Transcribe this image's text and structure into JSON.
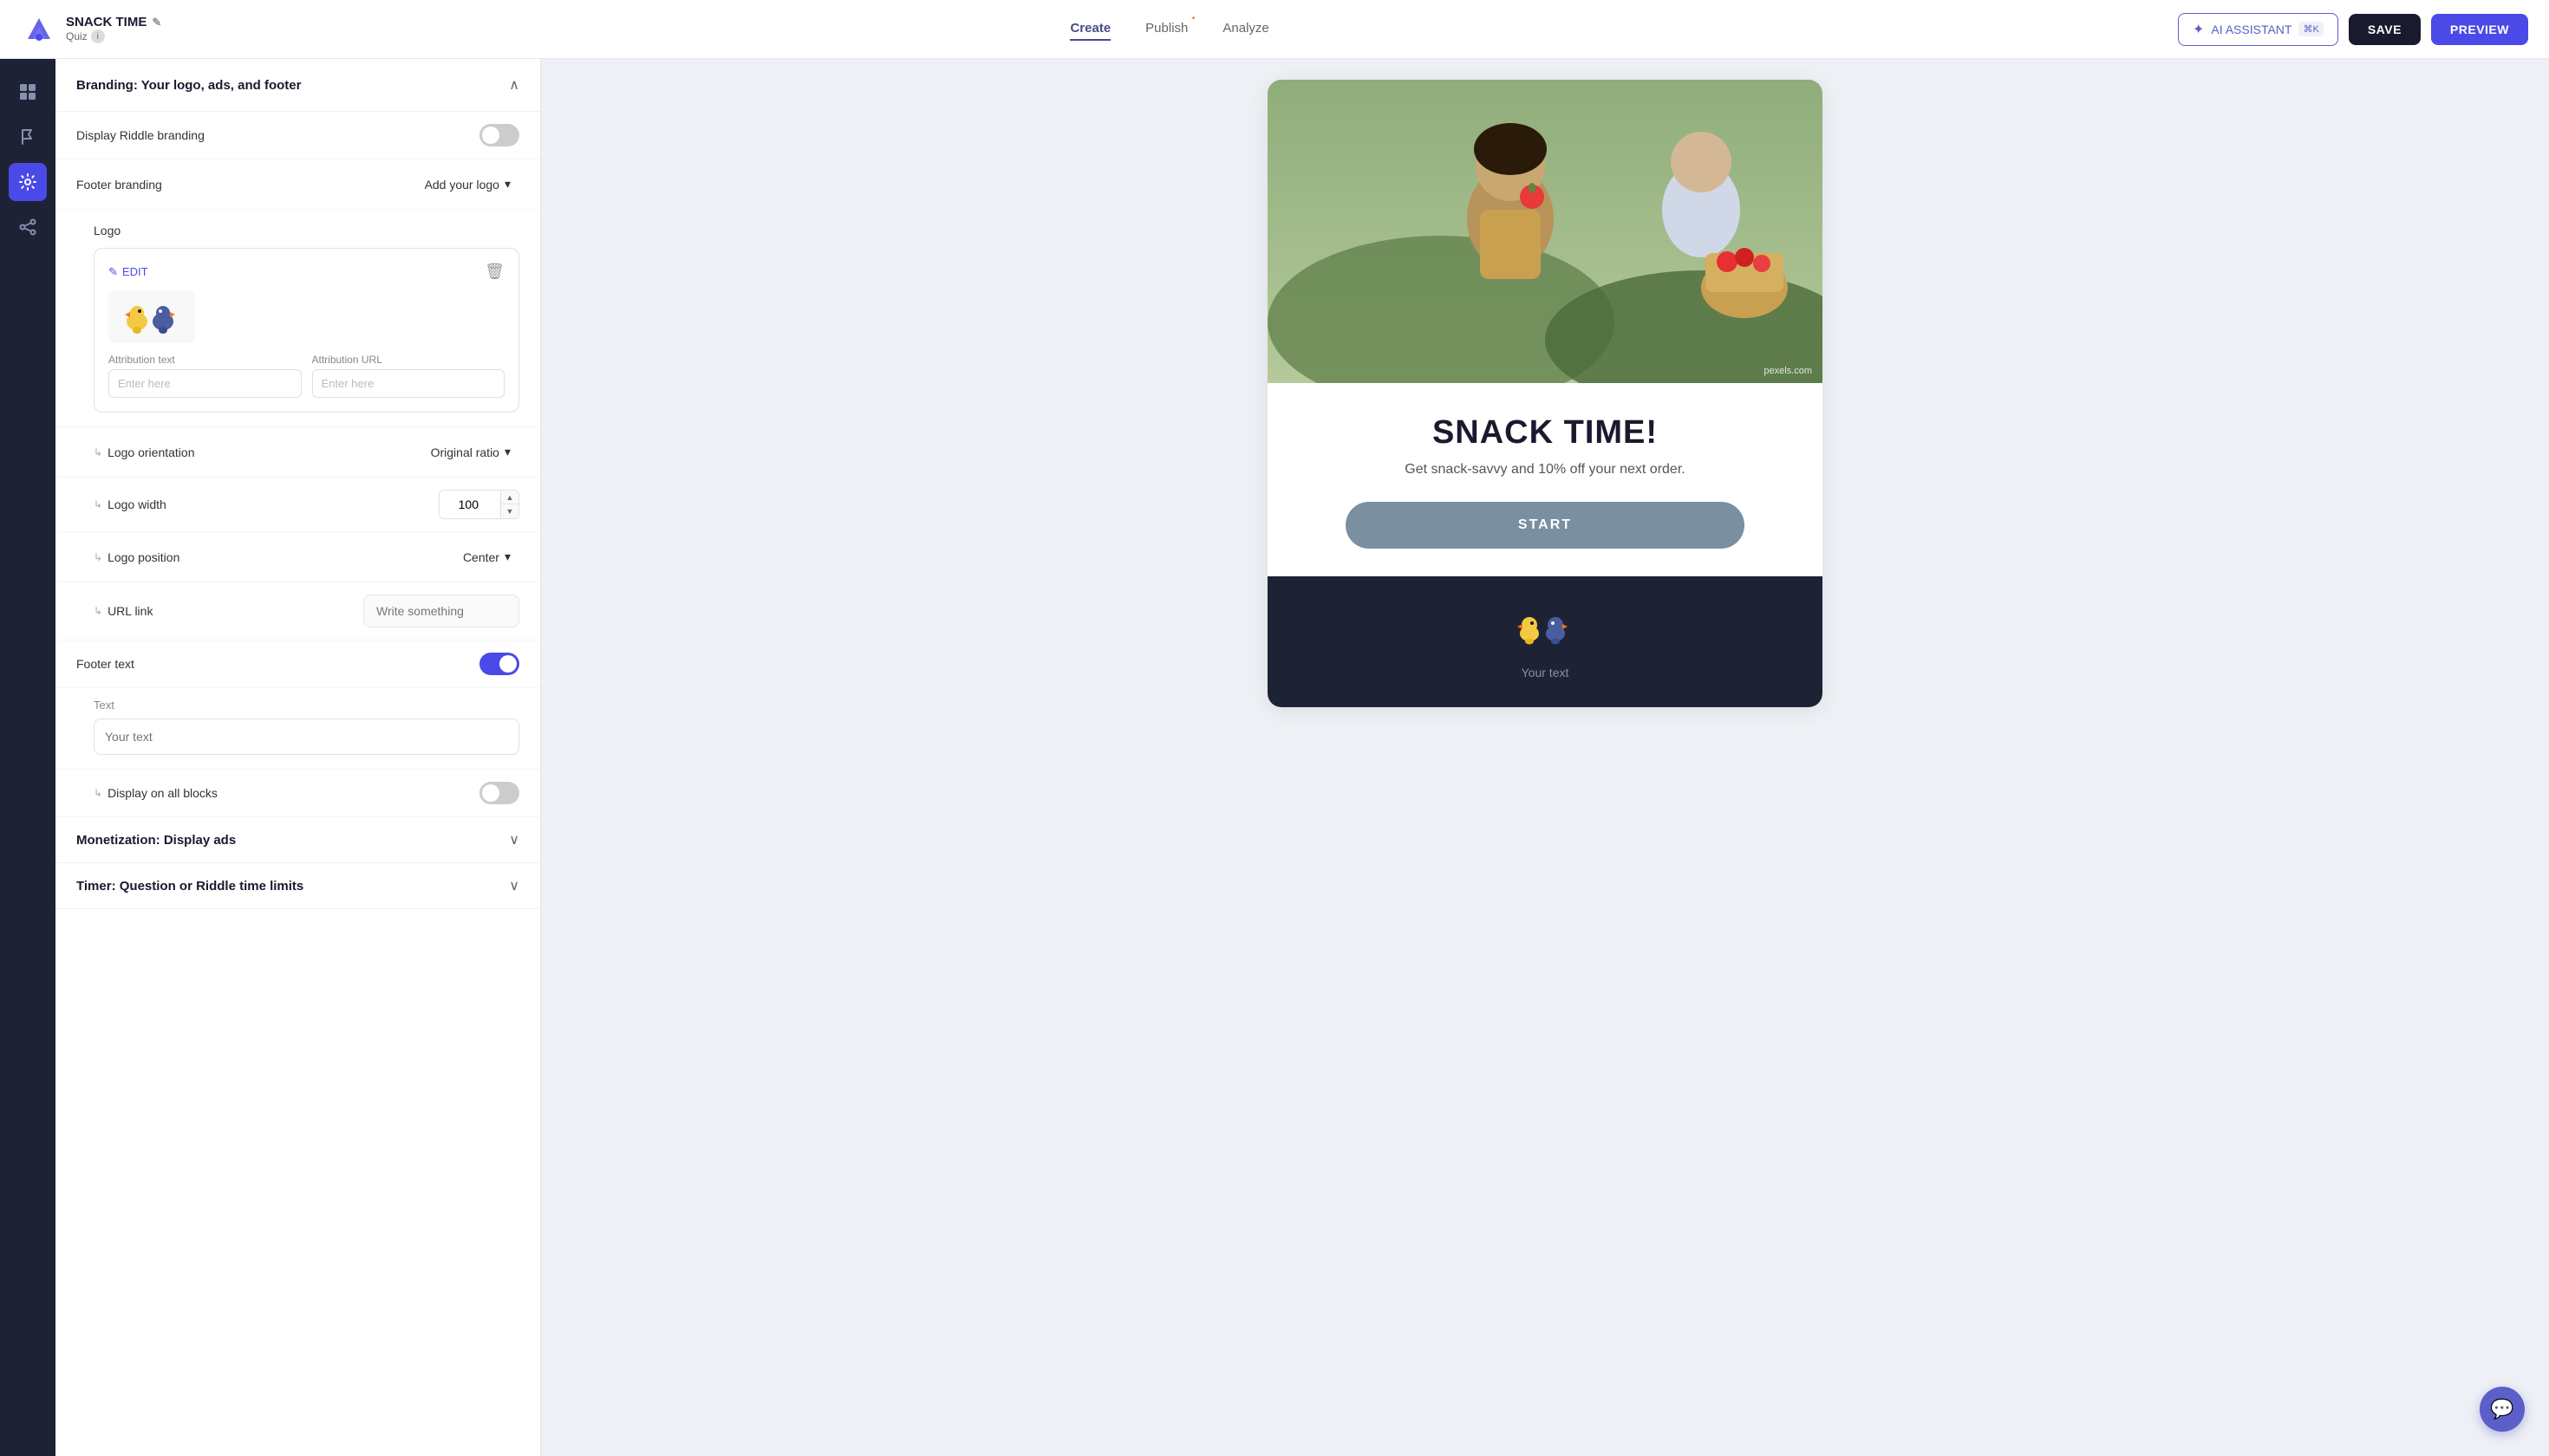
{
  "app": {
    "brand_name": "SNACK TIME",
    "brand_type": "Quiz",
    "nav_links": [
      {
        "id": "create",
        "label": "Create",
        "active": true
      },
      {
        "id": "publish",
        "label": "Publish",
        "active": false,
        "dot": true
      },
      {
        "id": "analyze",
        "label": "Analyze",
        "active": false
      }
    ],
    "ai_btn_label": "AI ASSISTANT",
    "ai_shortcut": "⌘K",
    "save_label": "SAVE",
    "preview_label": "PREVIEW"
  },
  "sidebar": {
    "icons": [
      {
        "id": "grid",
        "symbol": "⊞",
        "active": false
      },
      {
        "id": "flag",
        "symbol": "⚑",
        "active": false
      },
      {
        "id": "settings",
        "symbol": "⚙",
        "active": true
      },
      {
        "id": "share",
        "symbol": "↑",
        "active": false
      }
    ]
  },
  "panel": {
    "branding_title": "Branding: Your logo, ads, and footer",
    "display_riddle_label": "Display Riddle branding",
    "display_riddle_on": false,
    "footer_branding_label": "Footer branding",
    "add_logo_label": "Add your logo",
    "logo_label": "Logo",
    "edit_btn_label": "EDIT",
    "attribution_text_label": "Attribution text",
    "attribution_text_placeholder": "Enter here",
    "attribution_url_label": "Attribution URL",
    "attribution_url_placeholder": "Enter here",
    "logo_orientation_label": "Logo orientation",
    "logo_orientation_value": "Original ratio",
    "logo_width_label": "Logo width",
    "logo_width_value": "100",
    "logo_position_label": "Logo position",
    "logo_position_value": "Center",
    "url_link_label": "URL link",
    "url_link_placeholder": "Write something",
    "footer_text_label": "Footer text",
    "footer_text_on": true,
    "text_sub_label": "Text",
    "text_placeholder": "Your text",
    "display_all_blocks_label": "Display on all blocks",
    "display_all_blocks_on": false,
    "monetize_label": "Monetization: Display ads",
    "timer_label": "Timer: Question or Riddle time limits"
  },
  "preview": {
    "hero_alt": "Child eating apple",
    "pexels_credit": "pexels.com",
    "quiz_title": "SNACK TIME!",
    "quiz_subtitle": "Get snack-savvy and 10% off your next order.",
    "start_btn_label": "START",
    "footer_text": "Your text"
  },
  "colors": {
    "accent_blue": "#4a4ae8",
    "dark_bg": "#1e2235",
    "toggle_on": "#4a4ae8"
  }
}
